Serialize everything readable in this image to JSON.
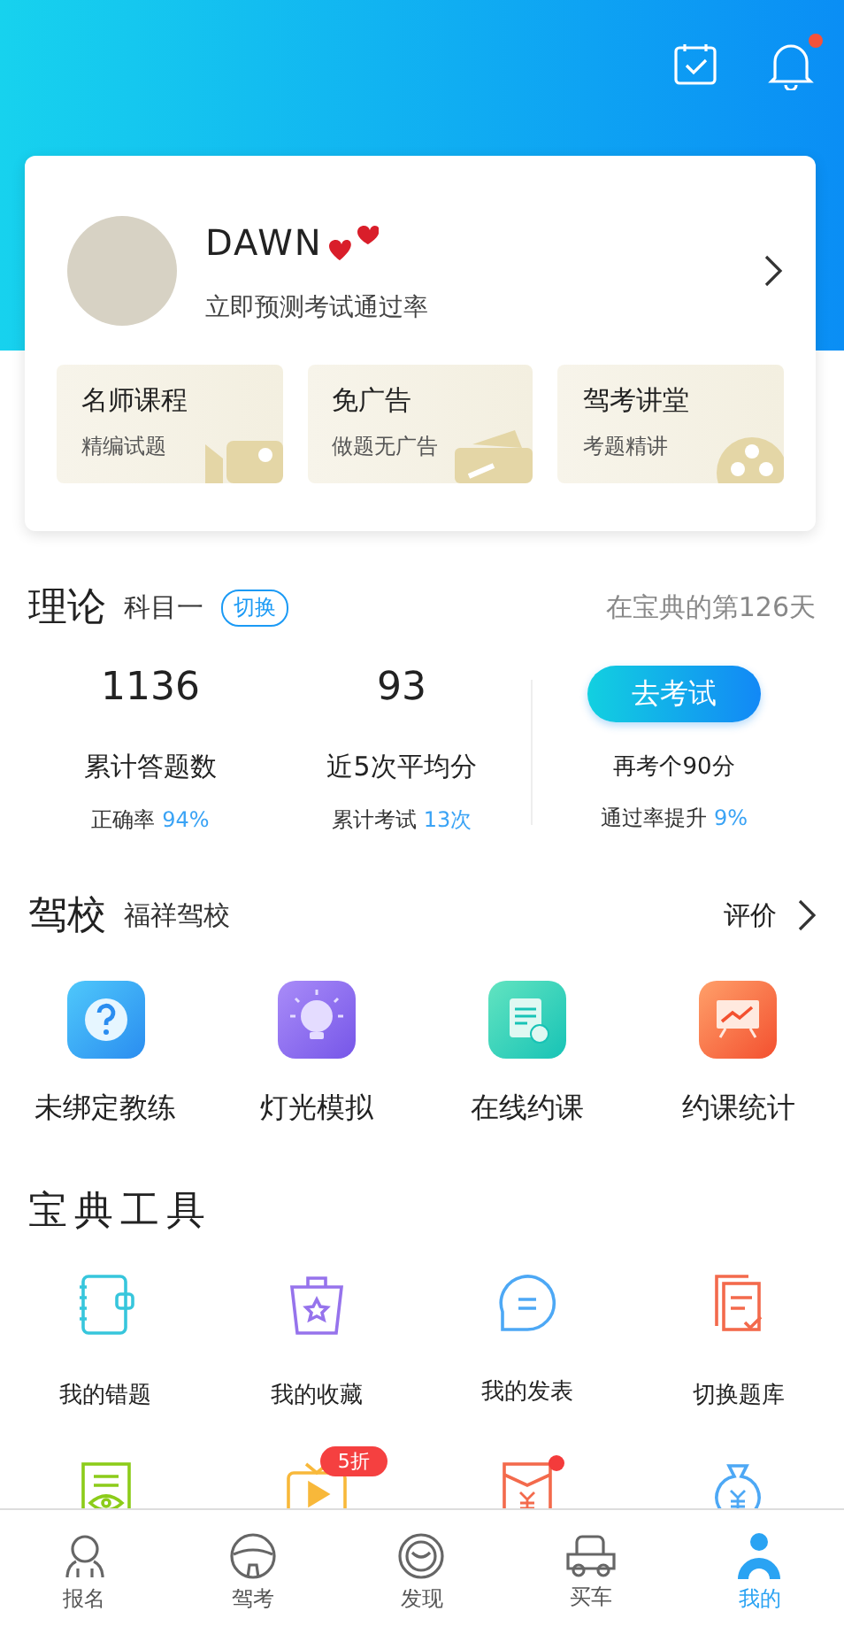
{
  "header": {
    "icons": [
      {
        "kind": "calendar",
        "badge": false
      },
      {
        "kind": "bell",
        "badge": true
      }
    ]
  },
  "profile": {
    "name": "DAWN",
    "subtitle": "立即预测考试通过率"
  },
  "promo_cards": [
    {
      "title": "名师课程",
      "subtitle": "精编试题",
      "kind": "video"
    },
    {
      "title": "免广告",
      "subtitle": "做题无广告",
      "kind": "ticket"
    },
    {
      "title": "驾考讲堂",
      "subtitle": "考题精讲",
      "kind": "film"
    }
  ],
  "theory": {
    "title": "理论",
    "subject": "科目一",
    "switch": "切换",
    "days": "在宝典的第126天",
    "stats": [
      {
        "value": "1136",
        "label": "累计答题数",
        "sub_label": "正确率",
        "sub_value": "94%"
      },
      {
        "value": "93",
        "label": "近5次平均分",
        "sub_label": "累计考试",
        "sub_value": "13次"
      }
    ],
    "exam_button": "去考试",
    "exam_hint": "再考个90分",
    "pass_label": "通过率提升",
    "pass_value": "9%"
  },
  "school": {
    "title": "驾校",
    "name": "福祥驾校",
    "rate": "评价",
    "items": [
      {
        "label": "未绑定教练",
        "kind": "question"
      },
      {
        "label": "灯光模拟",
        "kind": "bulb"
      },
      {
        "label": "在线约课",
        "kind": "schedule"
      },
      {
        "label": "约课统计",
        "kind": "chart"
      }
    ]
  },
  "tools": {
    "title": "宝典工具",
    "items": [
      {
        "label": "我的错题",
        "kind": "notebook"
      },
      {
        "label": "我的收藏",
        "kind": "star"
      },
      {
        "label": "我的发表",
        "kind": "chat"
      },
      {
        "label": "切换题库",
        "kind": "docs"
      },
      {
        "kind": "eye",
        "dot": false
      },
      {
        "kind": "tv",
        "badge": "5折",
        "dot": false
      },
      {
        "kind": "envelope",
        "dot": true
      },
      {
        "kind": "moneybag",
        "dot": false
      }
    ]
  },
  "nav": [
    {
      "label": "报名",
      "kind": "person",
      "selected": false
    },
    {
      "label": "驾考",
      "kind": "wheel",
      "selected": false
    },
    {
      "label": "发现",
      "kind": "face",
      "selected": false
    },
    {
      "label": "买车",
      "kind": "car",
      "selected": false
    },
    {
      "label": "我的",
      "kind": "driver",
      "selected": true
    }
  ]
}
